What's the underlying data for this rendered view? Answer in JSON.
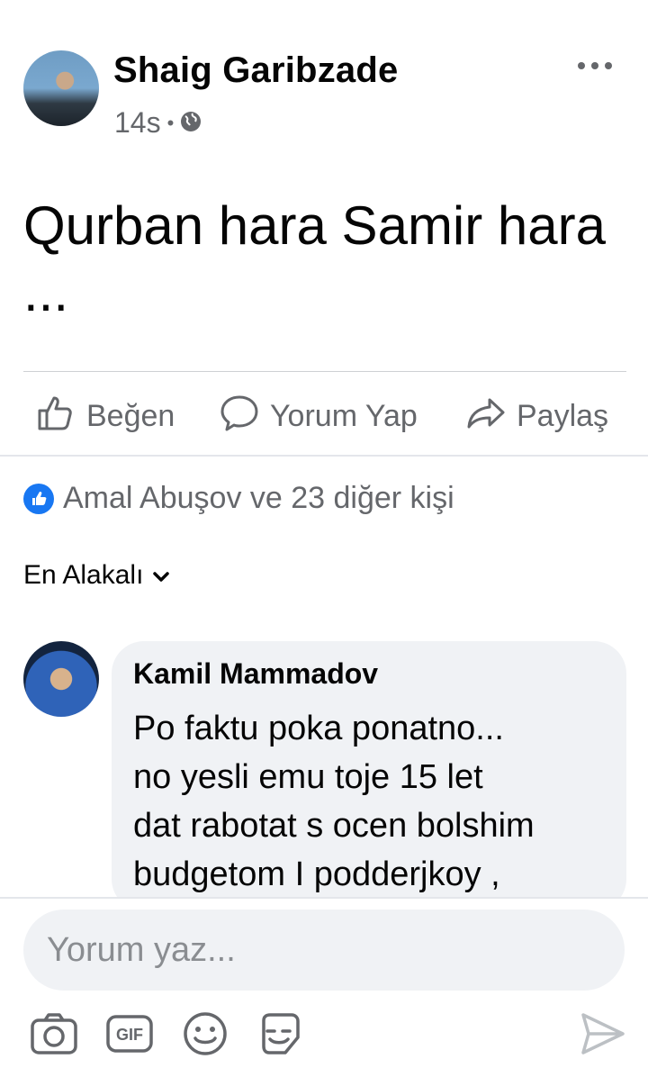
{
  "post": {
    "author": "Shaig Garibzade",
    "time": "14s",
    "separator": "•",
    "text": "Qurban hara Samir hara ..."
  },
  "actions": {
    "like": "Beğen",
    "comment": "Yorum Yap",
    "share": "Paylaş"
  },
  "reactions": {
    "summary": "Amal Abuşov ve 23 diğer kişi"
  },
  "sort": {
    "label": "En Alakalı"
  },
  "comments": [
    {
      "author": "Kamil Mammadov",
      "text": "Po faktu poka ponatno...\nno yesli emu toje 15 let\ndat rabotat s ocen bolshim\nbudgetom I podderjkoy ,"
    }
  ],
  "composer": {
    "placeholder": "Yorum yaz...",
    "tools": [
      "camera-icon",
      "gif-icon",
      "emoji-icon",
      "sticker-icon"
    ],
    "send_icon": "send-icon"
  },
  "colors": {
    "accent": "#1877f2",
    "secondary_text": "#65676b",
    "bubble": "#f0f2f5"
  }
}
